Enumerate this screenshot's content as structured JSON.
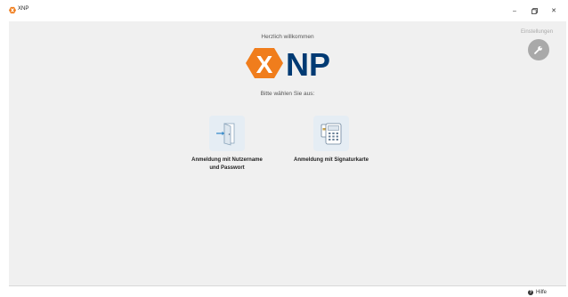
{
  "window": {
    "title": "XNP",
    "minimize_glyph": "–",
    "close_glyph": "✕"
  },
  "main": {
    "welcome": "Herzlich willkommen",
    "logo_text": "NP",
    "logo_badge": "X",
    "choose": "Bitte wählen Sie aus:",
    "settings_label": "Einstellungen",
    "settings_icon": "wrench-icon",
    "brand_color": "#f07d1c",
    "logo_color": "#003a73",
    "options": [
      {
        "label": "Anmeldung mit Nutzername und Passwort",
        "icon": "door-login-icon"
      },
      {
        "label": "Anmeldung mit Signaturkarte",
        "icon": "card-terminal-icon"
      }
    ]
  },
  "footer": {
    "help_label": "Hilfe",
    "help_glyph": "?"
  }
}
